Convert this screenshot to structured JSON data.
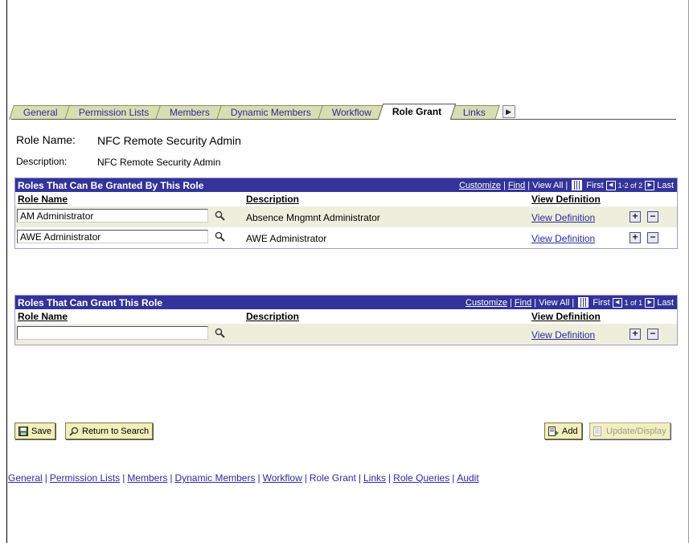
{
  "tabs": [
    {
      "label": "General",
      "active": false
    },
    {
      "label": "Permission Lists",
      "active": false
    },
    {
      "label": "Members",
      "active": false
    },
    {
      "label": "Dynamic Members",
      "active": false
    },
    {
      "label": "Workflow",
      "active": false
    },
    {
      "label": "Role Grant",
      "active": true
    },
    {
      "label": "Links",
      "active": false
    }
  ],
  "role": {
    "name_label": "Role Name:",
    "name_value": "NFC Remote Security Admin",
    "desc_label": "Description:",
    "desc_value": "NFC Remote Security Admin"
  },
  "grid1": {
    "title": "Roles That Can Be Granted By This Role",
    "customize": "Customize",
    "find": "Find",
    "view_all": "View All",
    "first": "First",
    "count": "1-2 of 2",
    "last": "Last",
    "col_role": "Role Name",
    "col_desc": "Description",
    "col_view": "View Definition",
    "rows": [
      {
        "role": "AM Administrator",
        "desc": "Absence Mngmnt Administrator",
        "view": "View Definition"
      },
      {
        "role": "AWE Administrator",
        "desc": "AWE Administrator",
        "view": "View Definition"
      }
    ]
  },
  "grid2": {
    "title": "Roles That Can Grant This Role",
    "customize": "Customize",
    "find": "Find",
    "view_all": "View All",
    "first": "First",
    "count": "1 of 1",
    "last": "Last",
    "col_role": "Role Name",
    "col_desc": "Description",
    "col_view": "View Definition",
    "rows": [
      {
        "role": "",
        "desc": "",
        "view": "View Definition"
      }
    ]
  },
  "buttons": {
    "save": "Save",
    "return": "Return to Search",
    "add": "Add",
    "update": "Update/Display"
  },
  "footer": {
    "general": "General",
    "permission_lists": "Permission Lists",
    "members": "Members",
    "dynamic_members": "Dynamic Members",
    "workflow": "Workflow",
    "role_grant": "Role Grant",
    "links": "Links",
    "role_queries": "Role Queries",
    "audit": "Audit"
  },
  "colors": {
    "header": "#333399",
    "tab": "#d9ddb2",
    "link": "#2b2b9b",
    "row_alt": "#eeeedd",
    "button": "#f2efbb"
  }
}
